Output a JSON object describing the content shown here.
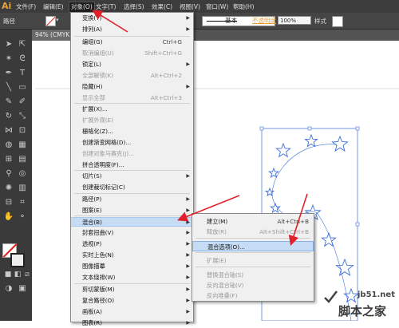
{
  "app": {
    "logo": "Ai"
  },
  "menubar": {
    "items": [
      {
        "label": "文件(F)"
      },
      {
        "label": "编辑(E)"
      },
      {
        "label": "对象(O)"
      },
      {
        "label": "文字(T)"
      },
      {
        "label": "选择(S)"
      },
      {
        "label": "效果(C)"
      },
      {
        "label": "视图(V)"
      },
      {
        "label": "窗口(W)"
      },
      {
        "label": "帮助(H)"
      }
    ]
  },
  "controlbar": {
    "path_label": "路径",
    "stroke_style": "基本",
    "opacity_label": "不透明度",
    "opacity_value": "100%",
    "style_label": "样式"
  },
  "document": {
    "tab_label": "94% (CMYK"
  },
  "object_menu": {
    "items": [
      {
        "label": "变换(T)",
        "shortcut": "",
        "submenu": true,
        "disabled": false
      },
      {
        "label": "排列(A)",
        "shortcut": "",
        "submenu": true,
        "disabled": false
      },
      {
        "label": "编组(G)",
        "shortcut": "Ctrl+G",
        "submenu": false,
        "disabled": false
      },
      {
        "label": "取消编组(U)",
        "shortcut": "Shift+Ctrl+G",
        "submenu": false,
        "disabled": true
      },
      {
        "label": "锁定(L)",
        "shortcut": "",
        "submenu": true,
        "disabled": false
      },
      {
        "label": "全部解锁(K)",
        "shortcut": "Alt+Ctrl+2",
        "submenu": false,
        "disabled": true
      },
      {
        "label": "隐藏(H)",
        "shortcut": "",
        "submenu": true,
        "disabled": false
      },
      {
        "label": "显示全部",
        "shortcut": "Alt+Ctrl+3",
        "submenu": false,
        "disabled": true
      },
      {
        "label": "扩展(X)...",
        "shortcut": "",
        "submenu": false,
        "disabled": false
      },
      {
        "label": "扩展外观(E)",
        "shortcut": "",
        "submenu": false,
        "disabled": true
      },
      {
        "label": "栅格化(Z)...",
        "shortcut": "",
        "submenu": false,
        "disabled": false
      },
      {
        "label": "创建渐变网格(D)...",
        "shortcut": "",
        "submenu": false,
        "disabled": false
      },
      {
        "label": "创建对象马赛克(J)...",
        "shortcut": "",
        "submenu": false,
        "disabled": true
      },
      {
        "label": "拼合透明度(F)...",
        "shortcut": "",
        "submenu": false,
        "disabled": false
      },
      {
        "label": "切片(S)",
        "shortcut": "",
        "submenu": true,
        "disabled": false
      },
      {
        "label": "创建裁切标记(C)",
        "shortcut": "",
        "submenu": false,
        "disabled": false
      },
      {
        "label": "路径(P)",
        "shortcut": "",
        "submenu": true,
        "disabled": false
      },
      {
        "label": "图案(E)",
        "shortcut": "",
        "submenu": true,
        "disabled": false
      },
      {
        "label": "混合(B)",
        "shortcut": "",
        "submenu": true,
        "disabled": false,
        "highlighted": true
      },
      {
        "label": "封套扭曲(V)",
        "shortcut": "",
        "submenu": true,
        "disabled": false
      },
      {
        "label": "透视(P)",
        "shortcut": "",
        "submenu": true,
        "disabled": false
      },
      {
        "label": "实时上色(N)",
        "shortcut": "",
        "submenu": true,
        "disabled": false
      },
      {
        "label": "图像描摹",
        "shortcut": "",
        "submenu": true,
        "disabled": false
      },
      {
        "label": "文本绕排(W)",
        "shortcut": "",
        "submenu": true,
        "disabled": false
      },
      {
        "label": "剪切蒙版(M)",
        "shortcut": "",
        "submenu": true,
        "disabled": false
      },
      {
        "label": "复合路径(O)",
        "shortcut": "",
        "submenu": true,
        "disabled": false
      },
      {
        "label": "画板(A)",
        "shortcut": "",
        "submenu": true,
        "disabled": false
      },
      {
        "label": "图表(R)",
        "shortcut": "",
        "submenu": true,
        "disabled": false
      }
    ]
  },
  "blend_submenu": {
    "items": [
      {
        "label": "建立(M)",
        "shortcut": "Alt+Ctrl+B",
        "disabled": false
      },
      {
        "label": "释放(R)",
        "shortcut": "Alt+Shift+Ctrl+B",
        "disabled": true
      },
      {
        "label": "混合选项(O)...",
        "shortcut": "",
        "disabled": false,
        "highlighted": true
      },
      {
        "label": "扩展(E)",
        "shortcut": "",
        "disabled": true
      },
      {
        "label": "替换混合轴(S)",
        "shortcut": "",
        "disabled": true
      },
      {
        "label": "反向混合轴(V)",
        "shortcut": "",
        "disabled": true
      },
      {
        "label": "反向堆叠(F)",
        "shortcut": "",
        "disabled": true
      }
    ]
  },
  "watermark": {
    "url": "jb51.net",
    "name": "脚本之家"
  },
  "colors": {
    "accent_orange": "#e8a13a",
    "annotation_red": "#e0202a",
    "selection_blue": "#3a6fd8",
    "menu_highlight": "#c6dcf5"
  }
}
